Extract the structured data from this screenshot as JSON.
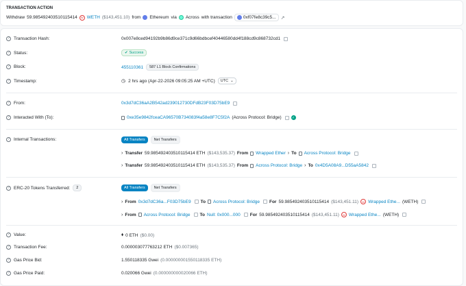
{
  "action": {
    "title": "TRANSACTION ACTION",
    "verb": "Withdraw",
    "amount": "59.985492403510115414",
    "token": "WETH",
    "usd": "($143,451.10)",
    "from_word": "from",
    "chain": "Ethereum",
    "via_word": "via",
    "protocol": "Across",
    "with_tx": "with transaction",
    "tx_short": "0xf07fe8c39c5..."
  },
  "fields": {
    "tx_hash": {
      "label": "Transaction Hash:",
      "value": "0x007e8ced94192b9b86d9ce371c9d66bdbcef40446580dd4f188cd9c868732cd1"
    },
    "status": {
      "label": "Status:",
      "value": "Success"
    },
    "block": {
      "label": "Block:",
      "value": "455110361",
      "confirmations": "587 L1 Block Confirmations"
    },
    "timestamp": {
      "label": "Timestamp:",
      "value": "2 hrs ago (Apr-22-2026 09:05:25 AM +UTC)",
      "tz": "UTC"
    },
    "from": {
      "label": "From:",
      "value": "0x3d7dC36aA2B542ad239012730DFdB23F03D75bE9"
    },
    "interacted": {
      "label": "Interacted With (To):",
      "value": "0xe35e9842fceaCA96570B734083f4a58e8F7C5f2A",
      "name": "(Across Protocol: Bridge)"
    },
    "internal": {
      "label": "Internal Transactions:",
      "tab_all": "All Transfers",
      "tab_net": "Net Transfers",
      "rows": [
        {
          "kind": "Transfer",
          "amount": "59.985492403510115414 ETH",
          "usd": "($143,535.37)",
          "from_word": "From",
          "from": "Wrapped Ether",
          "to_word": "To",
          "to": "Across Protocol: Bridge"
        },
        {
          "kind": "Transfer",
          "amount": "59.985492403510115414 ETH",
          "usd": "($143,535.37)",
          "from_word": "From",
          "from": "Across Protocol: Bridge",
          "to_word": "To",
          "to": "0x4D5A08A9...D55aA5842"
        }
      ]
    },
    "erc20": {
      "label": "ERC-20 Tokens Transferred:",
      "count": "2",
      "tab_all": "All Transfers",
      "tab_net": "Net Transfers",
      "rows": [
        {
          "from_word": "From",
          "from": "0x3d7dC36a...F03D75bE9",
          "to_word": "To",
          "to": "Across Protocol: Bridge",
          "for_word": "For",
          "amount": "59.985492403510115414",
          "usd": "($143,451.11)",
          "token": "Wrapped Ethe...",
          "symbol": "(WETH)"
        },
        {
          "from_word": "From",
          "from": "Across Protocol: Bridge",
          "to_word": "To",
          "to": "Null: 0x000...000",
          "for_word": "For",
          "amount": "59.985492403510115414",
          "usd": "($143,451.11)",
          "token": "Wrapped Ethe...",
          "symbol": "(WETH)"
        }
      ]
    },
    "value": {
      "label": "Value:",
      "value": "0 ETH",
      "usd": "($0.00)"
    },
    "fee": {
      "label": "Transaction Fee:",
      "value": "0.000003077763212 ETH",
      "usd": "($0.007365)"
    },
    "gas_bid": {
      "label": "Gas Price Bid:",
      "value": "1.550118335 Gwei",
      "eth": "(0.000000001550118335 ETH)"
    },
    "gas_paid": {
      "label": "Gas Price Paid:",
      "value": "0.020066 Gwei",
      "eth": "(0.000000000020066 ETH)"
    }
  },
  "colors": {
    "link": "#0784c3",
    "success": "#00a186"
  }
}
